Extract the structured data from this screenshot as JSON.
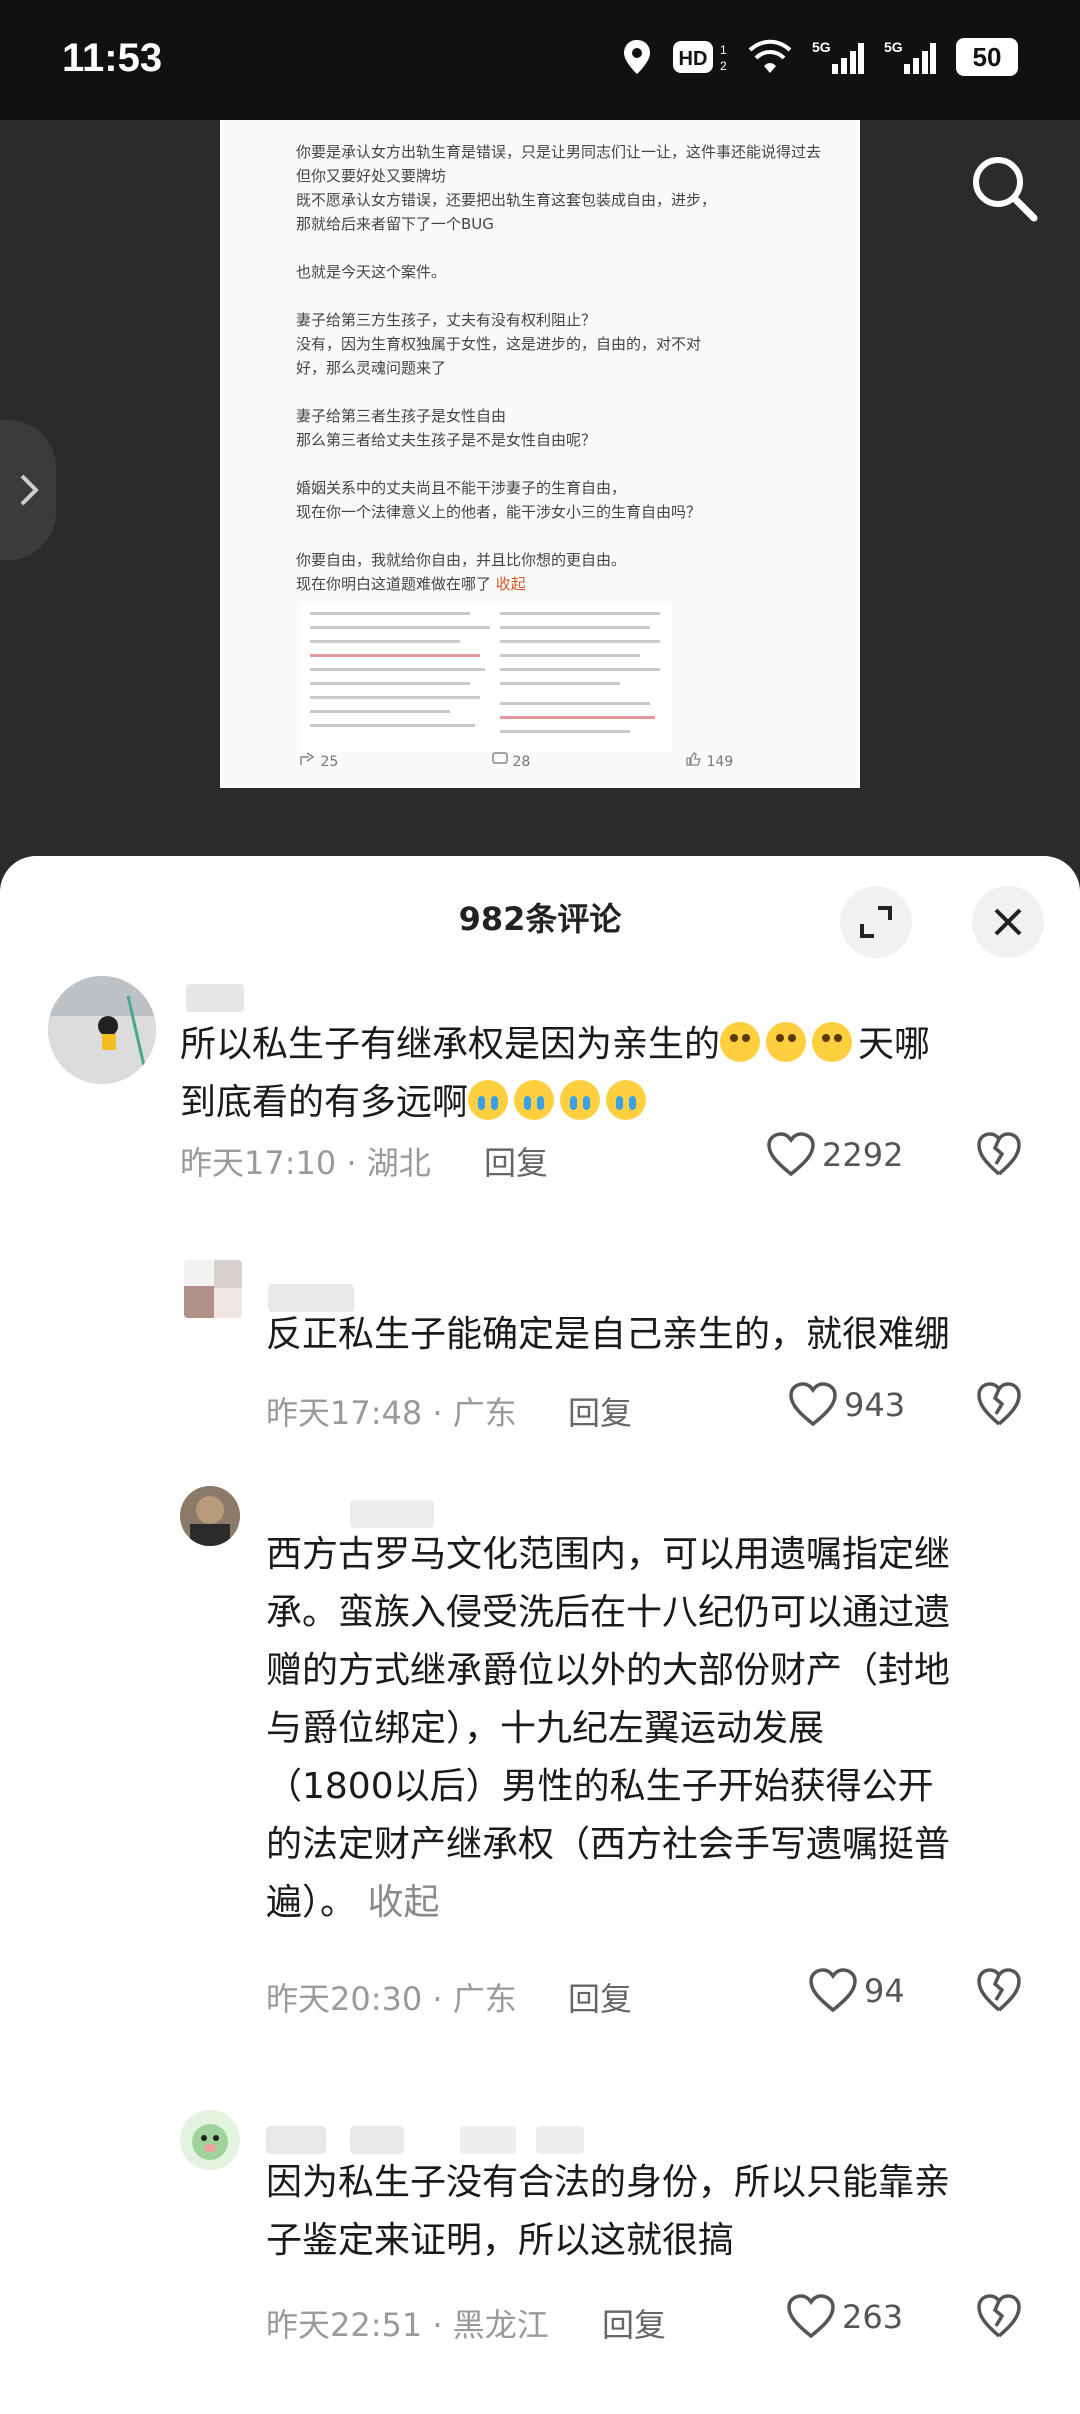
{
  "status_bar": {
    "time": "11:53",
    "battery": "50",
    "network_labels": [
      "HD",
      "5G",
      "5G"
    ],
    "icons": [
      "location-icon",
      "hd-icon",
      "wifi-icon",
      "signal-5g-icon",
      "signal-5g-icon-2",
      "battery-icon"
    ]
  },
  "viewer": {
    "doc_lines": [
      "你要是承认女方出轨生育是错误，只是让男同志们让一让，这件事还能说得过去",
      "但你又要好处又要牌坊",
      "既不愿承认女方错误，还要把出轨生育这套包装成自由，进步，",
      "那就给后来者留下了一个BUG",
      "",
      "也就是今天这个案件。",
      "",
      "妻子给第三方生孩子，丈夫有没有权利阻止？",
      "没有，因为生育权独属于女性，这是进步的，自由的，对不对",
      "好，那么灵魂问题来了",
      "",
      "妻子给第三者生孩子是女性自由",
      "那么第三者给丈夫生孩子是不是女性自由呢？",
      "",
      "婚姻关系中的丈夫尚且不能干涉妻子的生育自由，",
      "现在你一个法律意义上的他者，能干涉女小三的生育自由吗？",
      "",
      "你要自由，我就给你自由，并且比你想的更自由。"
    ],
    "doc_last_line": "现在你明白这道题难做在哪了",
    "doc_fold_link": "收起",
    "doc_footer": {
      "share": "25",
      "comments": "28",
      "likes": "149"
    }
  },
  "sheet": {
    "title": "982条评论",
    "expand_icon": "expand-icon",
    "close_icon": "close-icon"
  },
  "comments": [
    {
      "text_before": "所以私生子有继承权是因为亲生的",
      "text_mid": "天哪",
      "text_after": "到底看的有多远啊",
      "meta": "昨天17:10 · 湖北",
      "reply": "回复",
      "likes": "2292"
    },
    {
      "text": "反正私生子能确定是自己亲生的，就很难绷",
      "meta": "昨天17:48 · 广东",
      "reply": "回复",
      "likes": "943"
    },
    {
      "lines": [
        "西方古罗马文化范围内，可以用遗嘱指定继",
        "承。蛮族入侵受洗后在十八纪仍可以通过遗",
        "赠的方式继承爵位以外的大部份财产（封地",
        "与爵位绑定），十九纪左翼运动发展",
        "（1800以后）男性的私生子开始获得公开",
        "的法定财产继承权（西方社会手写遗嘱挺普"
      ],
      "last_line": "遍）。",
      "fold": "收起",
      "meta": "昨天20:30 · 广东",
      "reply": "回复",
      "likes": "94"
    },
    {
      "lines": [
        "因为私生子没有合法的身份，所以只能靠亲",
        "子鉴定来证明，所以这就很搞"
      ],
      "meta": "昨天22:51 · 黑龙江",
      "reply": "回复",
      "likes": "263"
    }
  ],
  "colors": {
    "accent_link": "#d05a2a",
    "sheet_bg": "#ffffff",
    "viewer_bg": "#2b2b2d"
  }
}
